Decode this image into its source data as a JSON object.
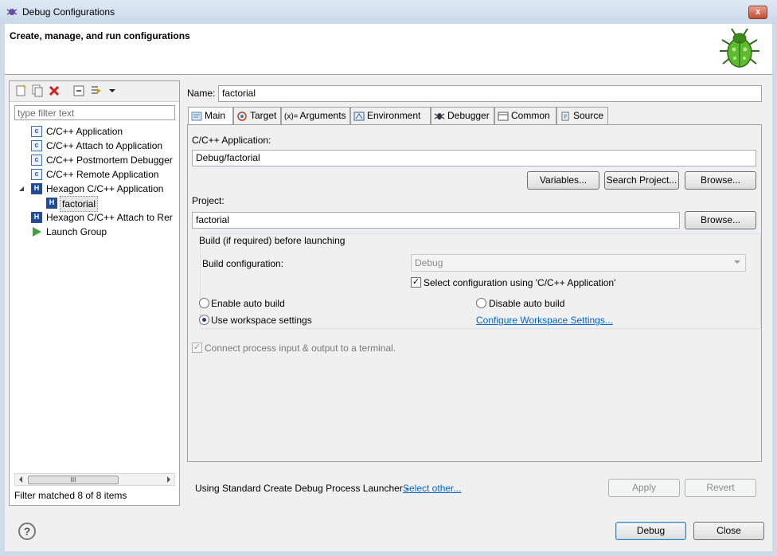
{
  "window": {
    "title": "Debug Configurations",
    "close_glyph": "x"
  },
  "header": {
    "title": "Create, manage, and run configurations",
    "icon": "bug-icon"
  },
  "left": {
    "toolbar": [
      "new-config-icon",
      "duplicate-icon",
      "delete-icon",
      "collapse-all-icon",
      "filter-icon",
      "dropdown-icon"
    ],
    "filter_placeholder": "type filter text",
    "tree": [
      {
        "label": "C/C++ Application",
        "icon": "c-config-icon"
      },
      {
        "label": "C/C++ Attach to Application",
        "icon": "c-config-icon"
      },
      {
        "label": "C/C++ Postmortem Debugger",
        "icon": "c-config-icon"
      },
      {
        "label": "C/C++ Remote Application",
        "icon": "c-config-icon"
      },
      {
        "label": "Hexagon C/C++ Application",
        "icon": "hexagon-icon",
        "expanded": true
      },
      {
        "label": "factorial",
        "icon": "hexagon-icon",
        "selected": true
      },
      {
        "label": "Hexagon C/C++ Attach to Rer",
        "icon": "hexagon-icon"
      },
      {
        "label": "Launch Group",
        "icon": "launch-group-icon"
      }
    ],
    "scroll_thumb_glyph": "III",
    "status": "Filter matched 8 of 8 items"
  },
  "name": {
    "label": "Name:",
    "value": "factorial"
  },
  "tabs": [
    {
      "label": "Main",
      "icon": "main-icon",
      "active": true
    },
    {
      "label": "Target",
      "icon": "target-icon"
    },
    {
      "label": "Arguments",
      "icon": "arguments-icon",
      "prefix": "(x)="
    },
    {
      "label": "Environment",
      "icon": "environment-icon"
    },
    {
      "label": "Debugger",
      "icon": "debugger-icon"
    },
    {
      "label": "Common",
      "icon": "common-icon"
    },
    {
      "label": "Source",
      "icon": "source-icon"
    }
  ],
  "main": {
    "app_label": "C/C++ Application:",
    "app_value": "Debug/factorial",
    "variables_button": "Variables...",
    "search_project_button": "Search Project...",
    "browse_app_button": "Browse...",
    "project_label": "Project:",
    "project_value": "factorial",
    "browse_project_button": "Browse...",
    "build_group_title": "Build (if required) before launching",
    "build_config_label": "Build configuration:",
    "build_config_value": "Debug",
    "select_config_label": "Select configuration using 'C/C++ Application'",
    "select_config_checked": true,
    "enable_auto_build": "Enable auto build",
    "disable_auto_build": "Disable auto build",
    "use_workspace": "Use workspace settings",
    "use_workspace_selected": true,
    "configure_workspace_link": "Configure Workspace Settings...",
    "connect_terminal_label": "Connect process input & output to a terminal.",
    "connect_terminal_checked": true
  },
  "footer": {
    "launcher_text": "Using Standard Create Debug Process Launcher -",
    "select_other_link": "Select other...",
    "apply_button": "Apply",
    "revert_button": "Revert",
    "debug_button": "Debug",
    "close_button": "Close",
    "help_glyph": "?"
  },
  "colors": {
    "accent": "#0066cc",
    "selection": "#e7e7e7",
    "window": "#f0f0f0"
  }
}
